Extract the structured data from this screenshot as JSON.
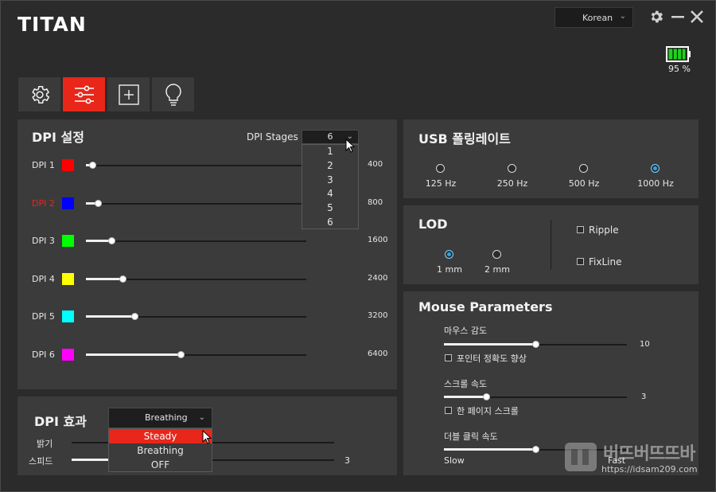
{
  "app": {
    "logo": "TITAN"
  },
  "header": {
    "language": "Korean",
    "battery_text": "95 %",
    "battery_percent": 95
  },
  "tabs": [
    {
      "name": "settings",
      "active": false
    },
    {
      "name": "adjust",
      "active": true
    },
    {
      "name": "macro",
      "active": false
    },
    {
      "name": "lighting",
      "active": false
    }
  ],
  "dpi_panel": {
    "title": "DPI 설정",
    "stages_label": "DPI Stages",
    "stages_value": "6",
    "stages_options": [
      "1",
      "2",
      "3",
      "4",
      "5",
      "6"
    ],
    "rows": [
      {
        "label": "DPI 1",
        "color": "#ff0000",
        "value": "400",
        "fraction": 0.03,
        "active": false
      },
      {
        "label": "DPI 2",
        "color": "#0000ff",
        "value": "800",
        "fraction": 0.055,
        "active": true
      },
      {
        "label": "DPI 3",
        "color": "#00ff00",
        "value": "1600",
        "fraction": 0.115,
        "active": false
      },
      {
        "label": "DPI 4",
        "color": "#ffff00",
        "value": "2400",
        "fraction": 0.165,
        "active": false
      },
      {
        "label": "DPI 5",
        "color": "#00ffff",
        "value": "3200",
        "fraction": 0.22,
        "active": false
      },
      {
        "label": "DPI 6",
        "color": "#ff00ff",
        "value": "6400",
        "fraction": 0.43,
        "active": false
      }
    ]
  },
  "effect_panel": {
    "title": "DPI 효과",
    "mode_value": "Breathing",
    "mode_options": [
      "Steady",
      "Breathing",
      "OFF"
    ],
    "selected_option": "Steady",
    "brightness_label": "밝기",
    "speed_label": "스피드",
    "speed_value": "3"
  },
  "usb_panel": {
    "title": "USB 폴링레이트",
    "options": [
      {
        "label": "125 Hz",
        "checked": false
      },
      {
        "label": "250 Hz",
        "checked": false
      },
      {
        "label": "500 Hz",
        "checked": false
      },
      {
        "label": "1000 Hz",
        "checked": true
      }
    ]
  },
  "lod_panel": {
    "title": "LOD",
    "options": [
      {
        "label": "1 mm",
        "checked": true
      },
      {
        "label": "2 mm",
        "checked": false
      }
    ],
    "ripple_label": "Ripple",
    "fixline_label": "FixLine"
  },
  "mouse_panel": {
    "title": "Mouse Parameters",
    "sensitivity_label": "마우스 감도",
    "sensitivity_value": "10",
    "sensitivity_fraction": 0.5,
    "precision_label": "포인터 정확도 향상",
    "scroll_label": "스크롤 속도",
    "scroll_value": "3",
    "scroll_fraction": 0.23,
    "page_scroll_label": "한 페이지 스크롤",
    "double_click_label": "더블 클릭 속도",
    "slow_label": "Slow",
    "fast_label": "Fast"
  },
  "watermark": {
    "text": "버뜨버뜨뜨바",
    "url": "https://idsam209.com"
  }
}
